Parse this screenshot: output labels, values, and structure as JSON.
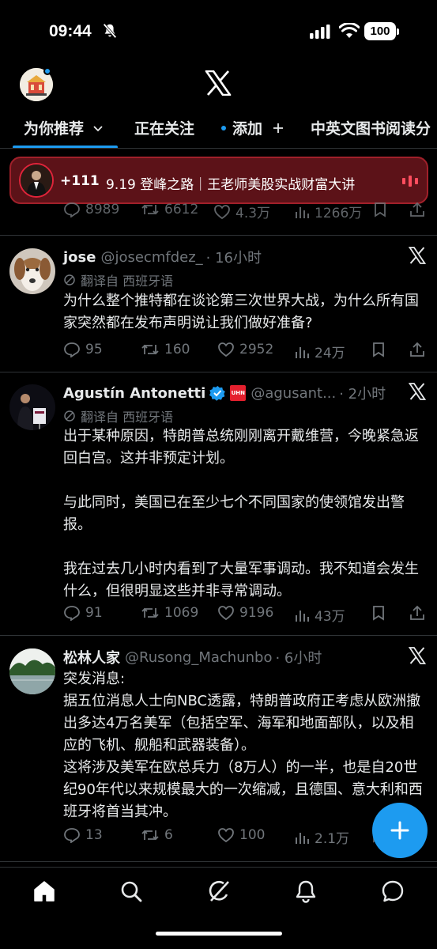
{
  "status_bar": {
    "time": "09:44",
    "battery": "100"
  },
  "tabs": [
    {
      "label": "为你推荐",
      "active": true
    },
    {
      "label": "正在关注",
      "active": false
    },
    {
      "label": "添加",
      "active": false
    },
    {
      "label": "中英文图书阅读分",
      "active": false
    }
  ],
  "live_banner": {
    "count": "+111",
    "title": "9.19 登峰之路｜王老师美股实战财富大讲"
  },
  "partial_tweet": {
    "replies": "8989",
    "reposts": "6612",
    "likes": "4.3万",
    "views": "1266万"
  },
  "tweets": [
    {
      "author": "jose",
      "handle": "@josecmfdez_",
      "time": "· 16小时",
      "translated": "翻译自 西班牙语",
      "text": "为什么整个推特都在谈论第三次世界大战，为什么所有国家突然都在发布声明说让我们做好准备?",
      "replies": "95",
      "reposts": "160",
      "likes": "2952",
      "views": "24万"
    },
    {
      "author": "Agustín Antonetti",
      "handle": "@agusant...",
      "time": "· 2小时",
      "affiliate_badge": "UHN",
      "translated": "翻译自 西班牙语",
      "text": "出于某种原因，特朗普总统刚刚离开戴维营，今晚紧急返回白宫。这并非预定计划。\n\n与此同时，美国已在至少七个不同国家的使领馆发出警报。\n\n我在过去几小时内看到了大量军事调动。我不知道会发生什么，但很明显这些并非寻常调动。",
      "replies": "91",
      "reposts": "1069",
      "likes": "9196",
      "views": "43万"
    },
    {
      "author": "松林人家",
      "handle": "@Rusong_Machunbo",
      "time": "· 6小时",
      "text": "突发消息:\n据五位消息人士向NBC透露，特朗普政府正考虑从欧洲撤出多达4万名美军（包括空军、海军和地面部队，以及相应的飞机、舰船和武器装备）。\n这将涉及美军在欧总兵力（8万人）的一半，也是自20世纪90年代以来规模最大的一次缩减，且德国、意大利和西班牙将首当其冲。",
      "replies": "13",
      "reposts": "6",
      "likes": "100",
      "views": "2.1万"
    }
  ],
  "colors": {
    "accent": "#1d9bf0",
    "muted": "#71767b",
    "banner_bg": "#5c1218",
    "verified": "#1d9bf0"
  },
  "icons": [
    "home-icon",
    "search-icon",
    "grok-icon",
    "notifications-icon",
    "messages-icon",
    "x-logo-icon",
    "compose-icon"
  ]
}
